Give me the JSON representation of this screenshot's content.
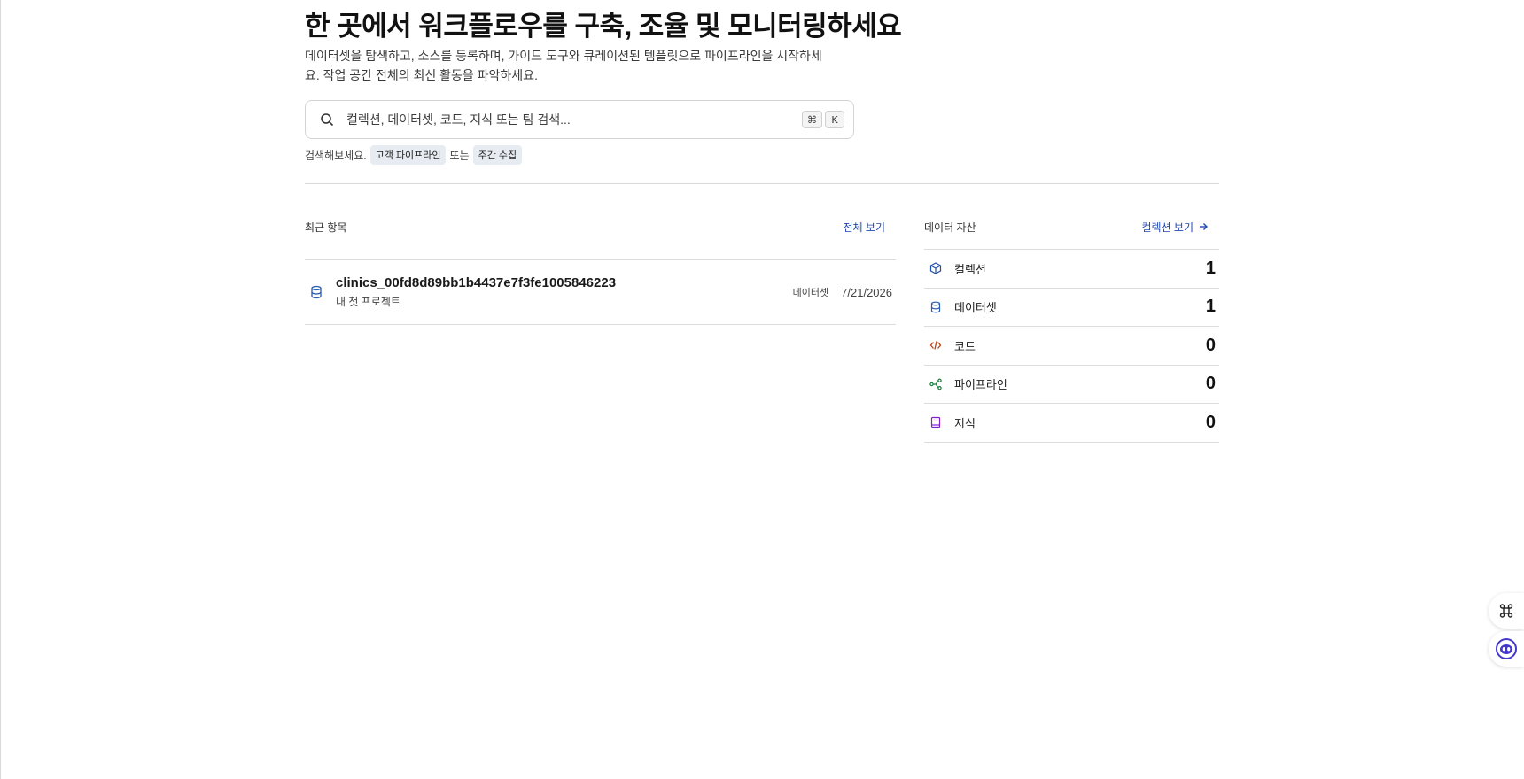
{
  "hero": {
    "title": "한 곳에서 워크플로우를 구축, 조율 및 모니터링하세요",
    "subtitle": "데이터셋을 탐색하고, 소스를 등록하며, 가이드 도구와 큐레이션된 템플릿으로 파이프라인을 시작하세요. 작업 공간 전체의 최신 활동을 파악하세요."
  },
  "search": {
    "placeholder": "컬렉션, 데이터셋, 코드, 지식 또는 팀 검색...",
    "value": "",
    "shortcut_key1": "⌘",
    "shortcut_key2": "K",
    "hint_prefix": "검색해보세요.",
    "hint_chip1": "고객 파이프라인",
    "hint_or": "또는",
    "hint_chip2": "주간 수집"
  },
  "recent": {
    "label": "최근 항목",
    "view_all": "전체 보기",
    "items": [
      {
        "icon": "database-icon",
        "title": "clinics_00fd8d89bb1b4437e7f3fe1005846223",
        "subtitle": "내 첫 프로젝트",
        "type": "데이터셋",
        "date": "7/21/2026"
      }
    ]
  },
  "assets": {
    "label": "데이터 자산",
    "view_collections": "컬렉션 보기",
    "items": [
      {
        "icon": "cube-icon",
        "label": "컬렉션",
        "count": "1",
        "color": "#1f4fa8"
      },
      {
        "icon": "database-icon",
        "label": "데이터셋",
        "count": "1",
        "color": "#2a5bb5"
      },
      {
        "icon": "code-icon",
        "label": "코드",
        "count": "0",
        "color": "#c2410c"
      },
      {
        "icon": "pipeline-icon",
        "label": "파이프라인",
        "count": "0",
        "color": "#15803d"
      },
      {
        "icon": "book-icon",
        "label": "지식",
        "count": "0",
        "color": "#7e22ce"
      }
    ]
  },
  "colors": {
    "accent_link": "#1f47b5",
    "chip_bg": "#e7ecf2",
    "assistant": "#4338ca"
  }
}
